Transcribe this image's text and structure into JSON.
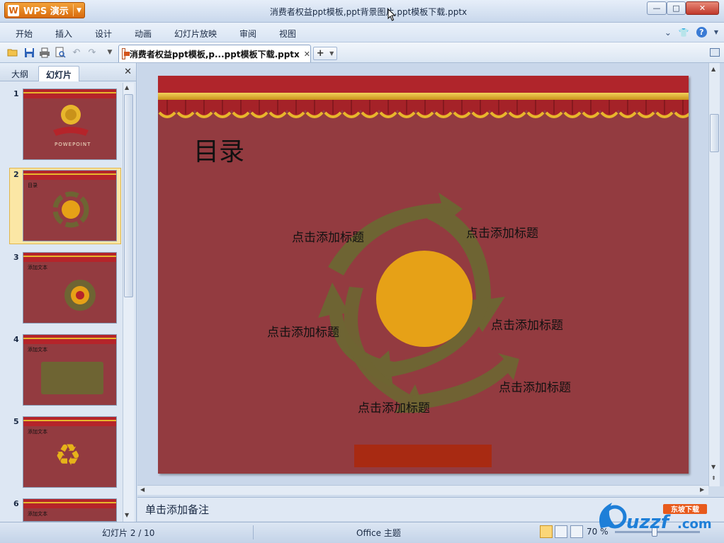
{
  "window": {
    "app_name": "WPS 演示",
    "title": "消费者权益ppt模板,ppt背景图片,ppt模板下载.pptx",
    "min_glyph": "—",
    "max_glyph": "□",
    "close_glyph": "✕"
  },
  "menu": {
    "items": [
      "开始",
      "插入",
      "设计",
      "动画",
      "幻灯片放映",
      "审阅",
      "视图"
    ]
  },
  "toolbar": {
    "doc_tab_label": "消费者权益ppt模板,p...ppt模板下载.pptx",
    "close_glyph": "✕",
    "new_tab_glyph": "+"
  },
  "left_panel": {
    "tabs": [
      "大纲",
      "幻灯片"
    ],
    "close_glyph": "✕",
    "selected_index": 2,
    "thumbnails": [
      {
        "num": "1",
        "title": "",
        "subtitle": "POWEPOINT"
      },
      {
        "num": "2",
        "title": "目录"
      },
      {
        "num": "3",
        "title": "添加文本"
      },
      {
        "num": "4",
        "title": "添加文本"
      },
      {
        "num": "5",
        "title": "添加文本"
      },
      {
        "num": "6",
        "title": "添加文本"
      }
    ]
  },
  "slide": {
    "title": "目录",
    "labels": [
      "点击添加标题",
      "点击添加标题",
      "点击添加标题",
      "点击添加标题",
      "点击添加标题",
      "点击添加标题"
    ],
    "colors": {
      "background": "#933b40",
      "curtain": "#b0252b",
      "gold": "#e8b62c",
      "circle": "#e6a117",
      "arrows": "#6e6433",
      "bar": "#a82a12"
    }
  },
  "notes": {
    "placeholder": "单击添加备注"
  },
  "status": {
    "slides": "幻灯片 2 / 10",
    "theme": "Office 主题",
    "zoom": "70 %"
  },
  "watermark": {
    "brand": "uzzf",
    "domain": ".com",
    "tag": "东坡下载"
  }
}
